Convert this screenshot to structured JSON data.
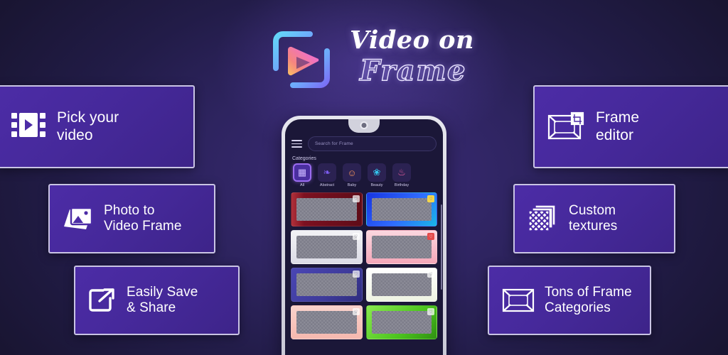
{
  "brand": {
    "line1": "Video on",
    "line2": "Frame",
    "logo_icon": "video-play-frame-logo",
    "accent_cyan": "#5ad0f5",
    "accent_blue": "#6f7bf7",
    "accent_pink": "#f77ac4",
    "accent_orange": "#f9b35c"
  },
  "theme": {
    "background_dark": "#191532",
    "background_mid": "#2e2460",
    "card_purple": "#4c2ca6",
    "card_border": "#c9c4e4",
    "text_white": "#ffffff"
  },
  "features": [
    {
      "id": "pick-your-video",
      "label": "Pick your\nvideo",
      "icon": "film-strip-play-icon"
    },
    {
      "id": "photo-to-video",
      "label": "Photo to\nVideo Frame",
      "icon": "photo-image-icon"
    },
    {
      "id": "easily-save-share",
      "label": "Easily Save\n& Share",
      "icon": "share-external-link-icon"
    },
    {
      "id": "frame-editor",
      "label": "Frame\neditor",
      "icon": "frame-crop-edit-icon"
    },
    {
      "id": "custom-textures",
      "label": "Custom\ntextures",
      "icon": "texture-stack-icon"
    },
    {
      "id": "tons-of-categories",
      "label": "Tons of Frame\nCategories",
      "icon": "empty-frame-icon"
    }
  ],
  "phone": {
    "menu_icon": "hamburger-menu-icon",
    "search": {
      "placeholder": "Search for Frame",
      "value": "",
      "icon": "search-field"
    },
    "categories_label": "Categories",
    "categories": [
      {
        "name": "All",
        "glyph": "▦",
        "active": true,
        "color": "#c9b6ff"
      },
      {
        "name": "Abstract",
        "glyph": "❧",
        "active": false,
        "color": "#7d5cf0"
      },
      {
        "name": "Baby",
        "glyph": "☺",
        "active": false,
        "color": "#f0915c"
      },
      {
        "name": "Beauty",
        "glyph": "❀",
        "active": false,
        "color": "#34c6ee"
      },
      {
        "name": "Birthday",
        "glyph": "♨",
        "active": false,
        "color": "#ef5fa0"
      }
    ],
    "frames": [
      {
        "id": "frame-1",
        "border_color": "#7c1020",
        "accent": "#d14a52",
        "favorited": false
      },
      {
        "id": "frame-2",
        "border_color": "#1734e0",
        "accent": "#2f6bff",
        "favorited": true
      },
      {
        "id": "frame-3",
        "border_color": "#f2f2f5",
        "accent": "#d9d9e2",
        "favorited": false
      },
      {
        "id": "frame-4",
        "border_color": "#f8c9d3",
        "accent": "#f4a7b9",
        "favorited": false
      },
      {
        "id": "frame-5",
        "border_color": "#3e3b9a",
        "accent": "#5a56c8",
        "favorited": false
      },
      {
        "id": "frame-6",
        "border_color": "#ffffff",
        "accent": "#c9e27f",
        "favorited": false
      },
      {
        "id": "frame-7",
        "border_color": "#f6c3bd",
        "accent": "#f7d9d4",
        "favorited": false
      },
      {
        "id": "frame-8",
        "border_color": "#5cd62a",
        "accent": "#8ae84f",
        "favorited": false
      }
    ],
    "favorite_icon": "heart-outline-icon"
  }
}
